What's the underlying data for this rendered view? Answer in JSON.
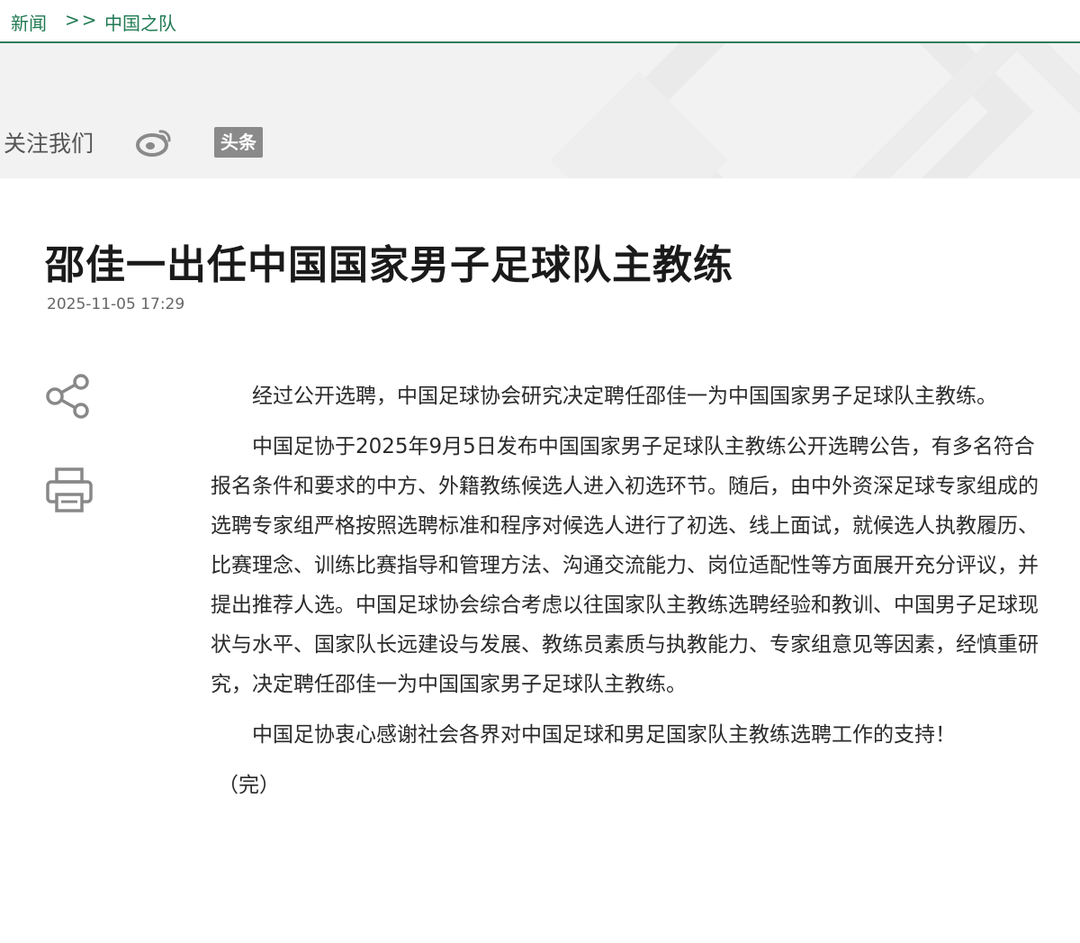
{
  "breadcrumb": {
    "home": "新闻",
    "separator": ">>",
    "current": "中国之队"
  },
  "follow": {
    "label": "关注我们",
    "icons": [
      "weibo-icon",
      "toutiao-icon"
    ],
    "toutiao_label": "头条"
  },
  "article": {
    "title": "邵佳一出任中国国家男子足球队主教练",
    "date": "2025-11-05 17:29",
    "paragraphs": [
      "经过公开选聘，中国足球协会研究决定聘任邵佳一为中国国家男子足球队主教练。",
      "中国足协于2025年9月5日发布中国国家男子足球队主教练公开选聘公告，有多名符合报名条件和要求的中方、外籍教练候选人进入初选环节。随后，由中外资深足球专家组成的选聘专家组严格按照选聘标准和程序对候选人进行了初选、线上面试，就候选人执教履历、比赛理念、训练比赛指导和管理方法、沟通交流能力、岗位适配性等方面展开充分评议，并提出推荐人选。中国足球协会综合考虑以往国家队主教练选聘经验和教训、中国男子足球现状与水平、国家队长远建设与发展、教练员素质与执教能力、专家组意见等因素，经慎重研究，决定聘任邵佳一为中国国家男子足球队主教练。",
      "中国足协衷心感谢社会各界对中国足球和男足国家队主教练选聘工作的支持！"
    ],
    "end_mark": "（完）"
  },
  "colors": {
    "accent": "#1f7a52",
    "band": "#f2f2f2",
    "icon_gray": "#8a8a8a"
  }
}
